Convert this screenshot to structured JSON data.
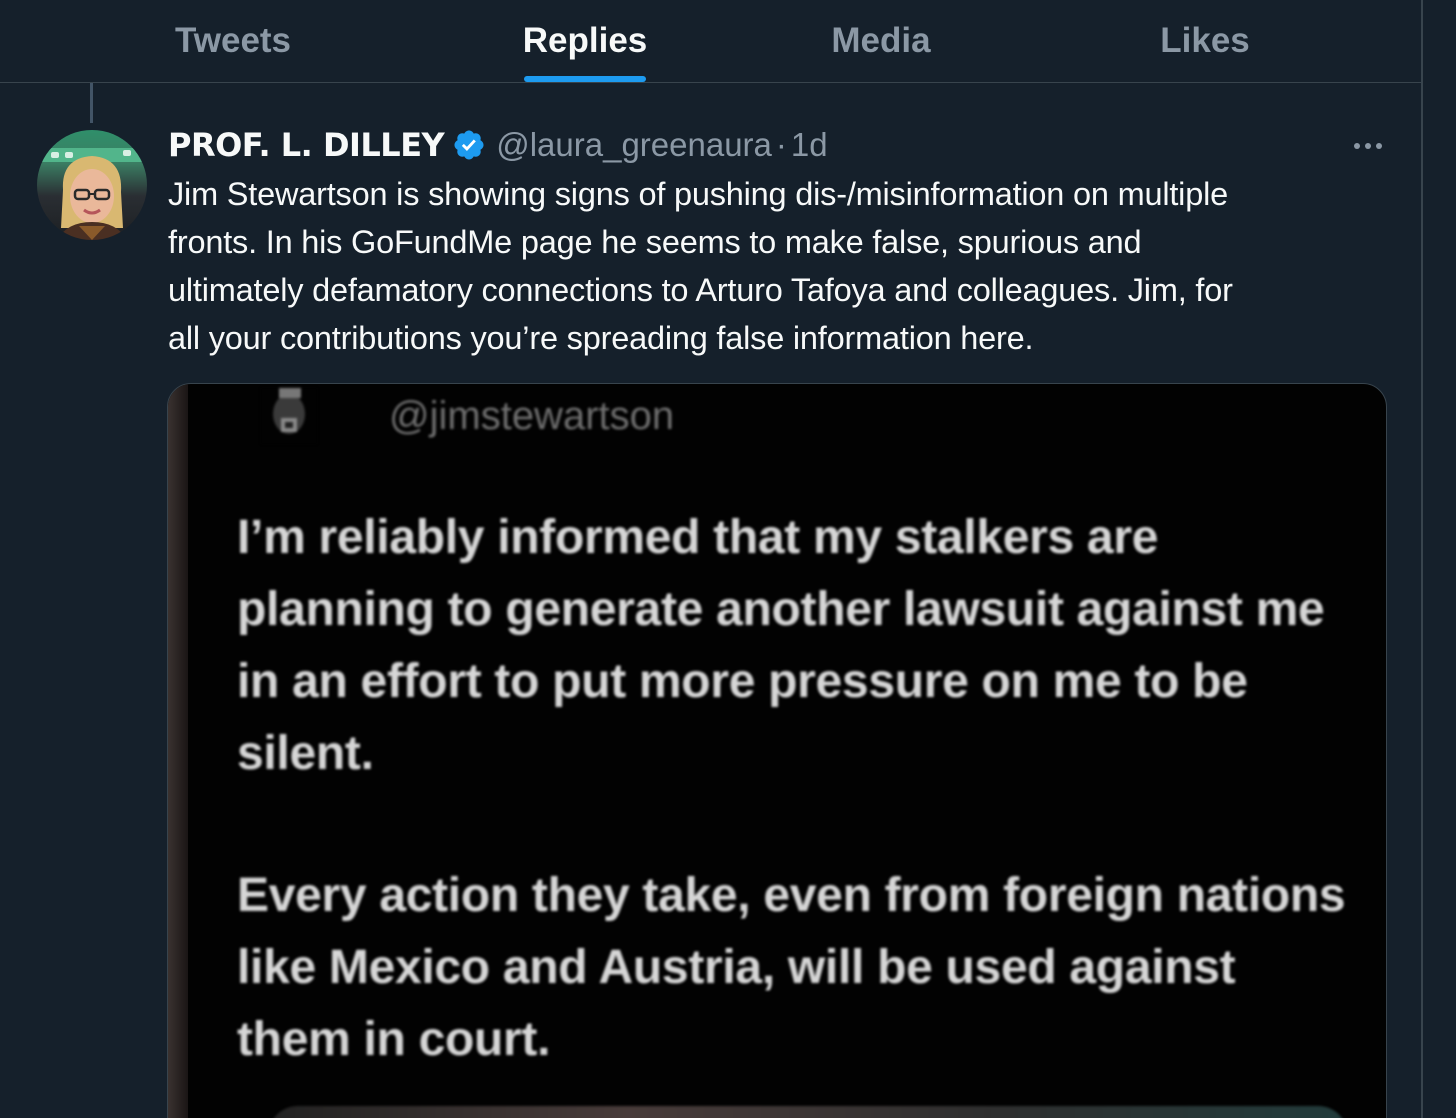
{
  "tabs": [
    {
      "label": "Tweets",
      "active": false
    },
    {
      "label": "Replies",
      "active": true
    },
    {
      "label": "Media",
      "active": false
    },
    {
      "label": "Likes",
      "active": false
    }
  ],
  "tweet": {
    "display_name": "PROF. L. DILLEY",
    "handle": "@laura_greenaura",
    "separator": "·",
    "time": "1d",
    "verified": true,
    "text_lines": [
      "Jim Stewartson is showing signs of pushing dis-/misinformation on multiple",
      "fronts. In his GoFundMe page he seems to make false, spurious and",
      "ultimately defamatory connections to Arturo Tafoya and colleagues. Jim, for",
      "all your contributions you’re spreading false information here."
    ],
    "media": {
      "handle": "@jimstewartson",
      "lines": [
        "I’m reliably informed that my stalkers are",
        "planning to generate another lawsuit against me",
        "in an effort to put more pressure on me to be",
        "silent.",
        "Every action they take, even from foreign nations",
        "like Mexico and Austria, will be used against",
        "them in court."
      ]
    }
  },
  "colors": {
    "background": "#15202b",
    "accent": "#1d9bf0",
    "muted_text": "#8b98a5",
    "primary_text": "#f7f9f9",
    "border": "#38444d"
  },
  "icons": {
    "verified": "verified-badge-icon",
    "more": "more-horizontal-icon"
  }
}
